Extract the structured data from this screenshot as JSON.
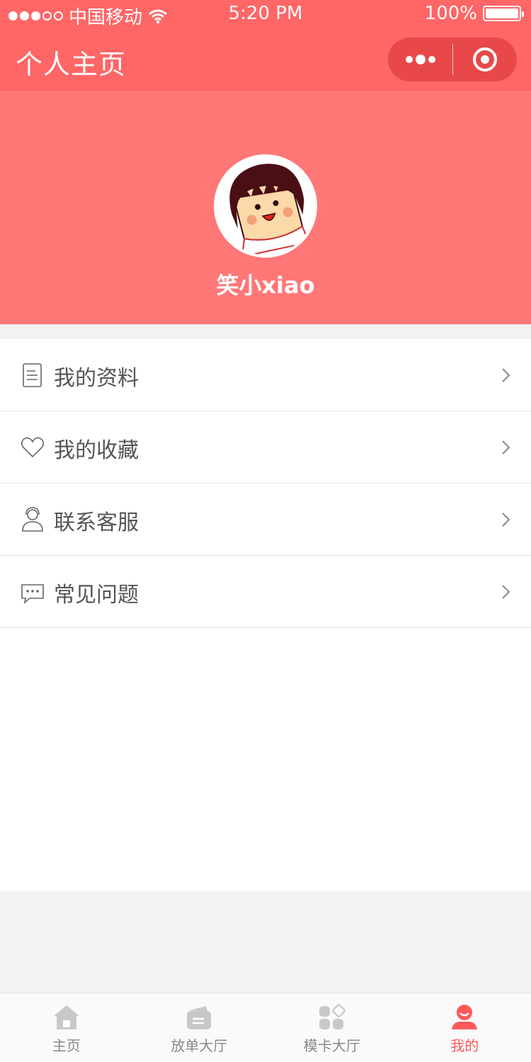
{
  "status_bar": {
    "carrier": "中国移动",
    "time": "5:20 PM",
    "battery": "100%"
  },
  "nav": {
    "title": "个人主页"
  },
  "profile": {
    "username": "笑小xiao"
  },
  "menu": {
    "items": [
      {
        "label": "我的资料",
        "icon": "document-icon"
      },
      {
        "label": "我的收藏",
        "icon": "heart-icon"
      },
      {
        "label": "联系客服",
        "icon": "customer-service-icon"
      },
      {
        "label": "常见问题",
        "icon": "chat-bubble-icon"
      }
    ]
  },
  "tabbar": {
    "items": [
      {
        "label": "主页",
        "icon": "home-icon"
      },
      {
        "label": "放单大厅",
        "icon": "order-hall-icon"
      },
      {
        "label": "模卡大厅",
        "icon": "card-hall-icon"
      },
      {
        "label": "我的",
        "icon": "user-icon",
        "active": true
      }
    ]
  },
  "colors": {
    "primary": "#ff6666",
    "profile_bg": "#ff7777",
    "active_tab": "#ff5a5a",
    "inactive_tab": "#c8c8c8"
  }
}
